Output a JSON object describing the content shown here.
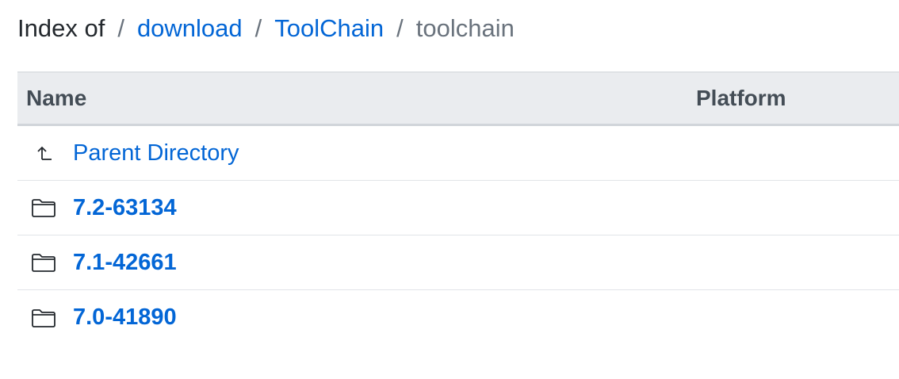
{
  "breadcrumb": {
    "prefix": "Index of",
    "separator": "/",
    "items": [
      {
        "label": "download",
        "link": true
      },
      {
        "label": "ToolChain",
        "link": true
      },
      {
        "label": "toolchain",
        "link": false
      }
    ]
  },
  "table": {
    "columns": [
      "Name",
      "Platform"
    ],
    "parent": {
      "label": "Parent Directory",
      "icon": "parent-directory-icon"
    },
    "rows": [
      {
        "name": "7.2-63134",
        "platform": "",
        "icon": "folder-icon"
      },
      {
        "name": "7.1-42661",
        "platform": "",
        "icon": "folder-icon"
      },
      {
        "name": "7.0-41890",
        "platform": "",
        "icon": "folder-icon"
      }
    ]
  },
  "colors": {
    "link": "#0366d6",
    "text": "#24292e",
    "muted": "#6a737d",
    "header_bg": "#eaecef"
  }
}
